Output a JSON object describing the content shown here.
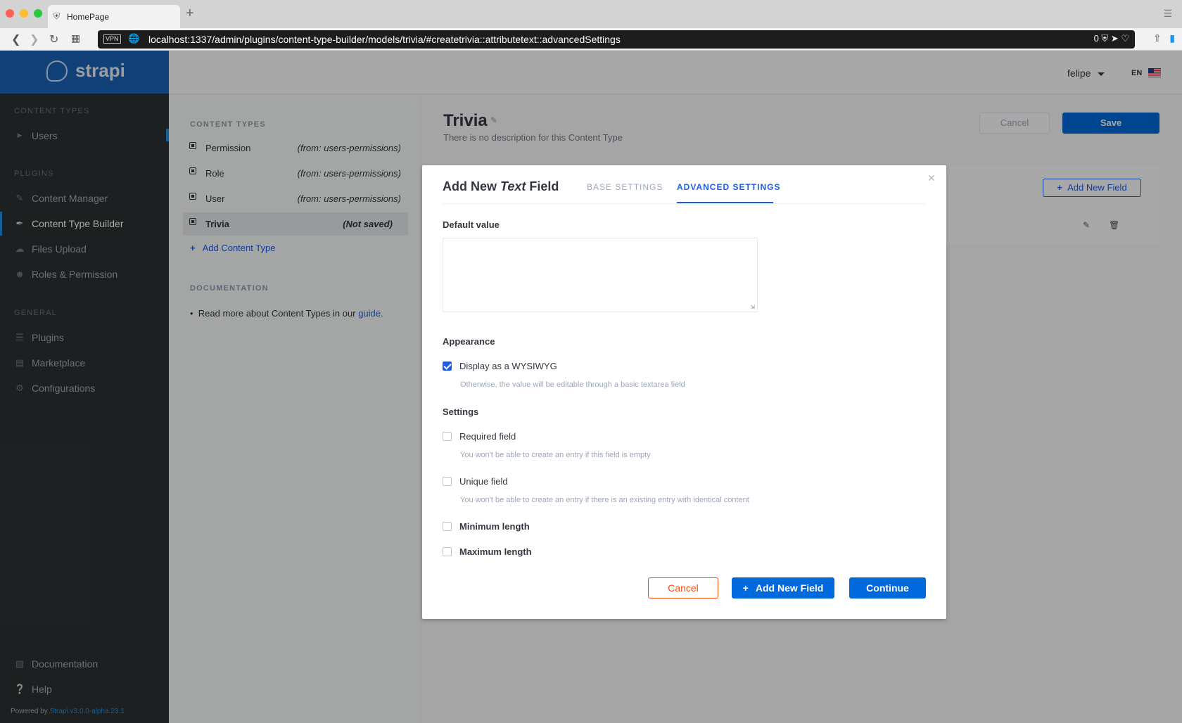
{
  "browser": {
    "tab_title": "HomePage",
    "vpn_label": "VPN",
    "url": "localhost:1337/admin/plugins/content-type-builder/models/trivia/#createtrivia::attributetext::advancedSettings",
    "ad_block_count": "0"
  },
  "sidebar": {
    "brand": "strapi",
    "content_types_header": "CONTENT TYPES",
    "content_types": [
      {
        "label": "Users",
        "icon": "caret-right-icon"
      }
    ],
    "plugins_header": "PLUGINS",
    "plugins": [
      {
        "label": "Content Manager",
        "icon": "pencil-icon"
      },
      {
        "label": "Content Type Builder",
        "icon": "paint-brush-icon"
      },
      {
        "label": "Files Upload",
        "icon": "cloud-upload-icon"
      },
      {
        "label": "Roles & Permission",
        "icon": "users-icon"
      }
    ],
    "general_header": "GENERAL",
    "general": [
      {
        "label": "Plugins",
        "icon": "list-icon"
      },
      {
        "label": "Marketplace",
        "icon": "shopping-basket-icon"
      },
      {
        "label": "Configurations",
        "icon": "gear-icon"
      }
    ],
    "bottom": [
      {
        "label": "Documentation",
        "icon": "book-icon"
      },
      {
        "label": "Help",
        "icon": "question-circle-icon"
      }
    ],
    "powered_by_prefix": "Powered by",
    "powered_by_version": "Strapi v3.0.0-alpha.23.1"
  },
  "header": {
    "username": "felipe",
    "language": "EN"
  },
  "ctb": {
    "content_types_header": "CONTENT TYPES",
    "items": [
      {
        "name": "Permission",
        "source": "(from: users-permissions)"
      },
      {
        "name": "Role",
        "source": "(from: users-permissions)"
      },
      {
        "name": "User",
        "source": "(from: users-permissions)"
      },
      {
        "name": "Trivia",
        "source": "(Not saved)"
      }
    ],
    "add_content_type": "Add Content Type",
    "documentation_header": "DOCUMENTATION",
    "doc_text": "Read more about Content Types in our",
    "doc_link": "guide."
  },
  "main": {
    "title": "Trivia",
    "description": "There is no description for this Content Type",
    "cancel_label": "Cancel",
    "save_label": "Save",
    "add_field_label": "Add New Field"
  },
  "modal": {
    "title_prefix": "Add New",
    "title_type": "Text",
    "title_suffix": "Field",
    "tab_base": "BASE SETTINGS",
    "tab_advanced": "ADVANCED SETTINGS",
    "default_value_label": "Default value",
    "default_value": "",
    "appearance_label": "Appearance",
    "wysiwyg_label": "Display as a WYSIWYG",
    "wysiwyg_checked": true,
    "wysiwyg_help": "Otherwise, the value will be editable through a basic textarea field",
    "settings_label": "Settings",
    "required_label": "Required field",
    "required_help": "You won't be able to create an entry if this field is empty",
    "unique_label": "Unique field",
    "unique_help": "You won't be able to create an entry if there is an existing entry with identical content",
    "min_length_label": "Minimum length",
    "max_length_label": "Maximum length",
    "cancel_label": "Cancel",
    "add_field_label": "Add New Field",
    "continue_label": "Continue"
  },
  "colors": {
    "sidebar_bg": "#2d3133",
    "brand_bg": "#1c63b8",
    "primary": "#0069db",
    "link": "#1c5de7",
    "danger": "#f64d0a"
  }
}
